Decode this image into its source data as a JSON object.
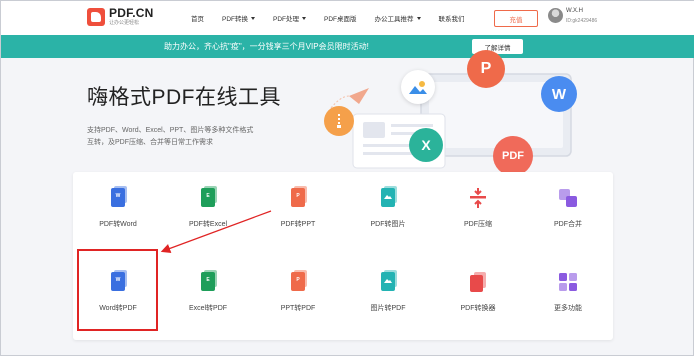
{
  "header": {
    "logo_name": "PDF.CN",
    "logo_sub": "让办公更轻松",
    "nav": [
      {
        "label": "首页",
        "has_caret": false
      },
      {
        "label": "PDF转换",
        "has_caret": true
      },
      {
        "label": "PDF处理",
        "has_caret": true
      },
      {
        "label": "PDF桌面版",
        "has_caret": false
      },
      {
        "label": "办公工具推荐",
        "has_caret": true
      },
      {
        "label": "联系我们",
        "has_caret": false
      }
    ],
    "recharge_label": "充值",
    "user_name": "W.X.H",
    "user_id": "ID:gk2429486"
  },
  "banner": {
    "text": "助力办公，齐心抗\"疫\"，一分钱享三个月VIP会员限时活动!",
    "button_label": "了解详情",
    "color": "#2bb3a7"
  },
  "hero": {
    "title": "嗨格式PDF在线工具",
    "desc_line1": "支持PDF、Word、Excel、PPT、图片等多种文件格式",
    "desc_line2": "互转，及PDF压缩、合并等日常工作需求"
  },
  "illustration": {
    "bubbles": [
      {
        "name": "ppt-bubble-icon",
        "letter": "P",
        "color": "#ef6a4a"
      },
      {
        "name": "word-bubble-icon",
        "letter": "W",
        "color": "#4a8cf0"
      },
      {
        "name": "excel-bubble-icon",
        "letter": "X",
        "color": "#2bb39a"
      },
      {
        "name": "pdf-bubble-icon",
        "letter": "PDF",
        "color": "#f06a5a"
      },
      {
        "name": "image-bubble-icon",
        "letter": "",
        "color": "#ffffff"
      },
      {
        "name": "zip-bubble-icon",
        "letter": "",
        "color": "#f5a04a"
      }
    ]
  },
  "tools": [
    {
      "label": "PDF转Word",
      "icon": "pdf-to-word-icon",
      "color": "#3a6fe0",
      "letter": "W"
    },
    {
      "label": "PDF转Excel",
      "icon": "pdf-to-excel-icon",
      "color": "#1e9e5a",
      "letter": "E"
    },
    {
      "label": "PDF转PPT",
      "icon": "pdf-to-ppt-icon",
      "color": "#ef6a4a",
      "letter": "P"
    },
    {
      "label": "PDF转图片",
      "icon": "pdf-to-image-icon",
      "color": "#23b3b3",
      "letter": ""
    },
    {
      "label": "PDF压缩",
      "icon": "pdf-compress-icon",
      "color": "#e84a4a",
      "letter": ""
    },
    {
      "label": "PDF合并",
      "icon": "pdf-merge-icon",
      "color": "#8a5ae0",
      "letter": ""
    },
    {
      "label": "Word转PDF",
      "icon": "word-to-pdf-icon",
      "color": "#3a6fe0",
      "letter": "W"
    },
    {
      "label": "Excel转PDF",
      "icon": "excel-to-pdf-icon",
      "color": "#1e9e5a",
      "letter": "E"
    },
    {
      "label": "PPT转PDF",
      "icon": "ppt-to-pdf-icon",
      "color": "#ef6a4a",
      "letter": "P"
    },
    {
      "label": "图片转PDF",
      "icon": "image-to-pdf-icon",
      "color": "#23b3b3",
      "letter": ""
    },
    {
      "label": "PDF转换器",
      "icon": "pdf-converter-icon",
      "color": "#e84a4a",
      "letter": ""
    },
    {
      "label": "更多功能",
      "icon": "more-features-icon",
      "color": "#8a5ae0",
      "letter": ""
    }
  ]
}
